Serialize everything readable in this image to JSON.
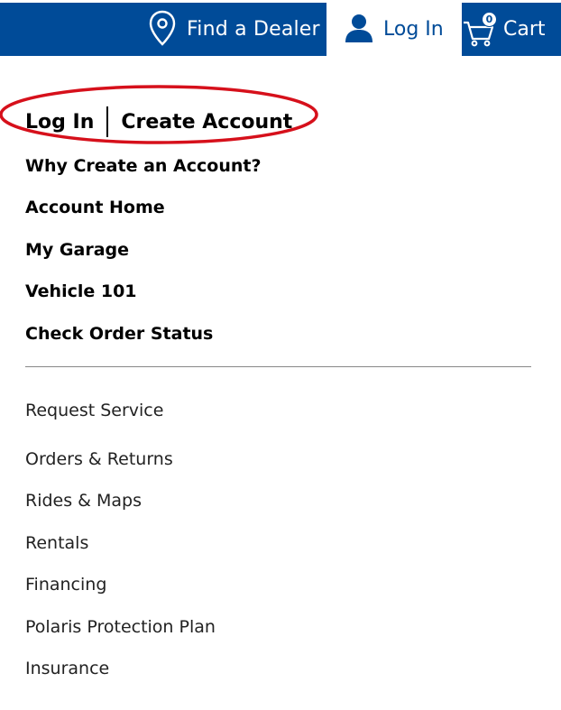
{
  "header": {
    "dealer_label": "Find a Dealer",
    "login_label": "Log In",
    "cart_label": "Cart",
    "cart_count": "0",
    "colors": {
      "brand_blue": "#004b98",
      "highlight_red": "#d6101b"
    }
  },
  "auth": {
    "login": "Log In",
    "create_account": "Create Account"
  },
  "account_links": [
    "Why Create an Account?",
    "Account Home",
    "My Garage",
    "Vehicle 101",
    "Check Order Status"
  ],
  "support_links": [
    "Request Service",
    "Orders & Returns",
    "Rides & Maps",
    "Rentals",
    "Financing",
    "Polaris Protection Plan",
    "Insurance"
  ],
  "icons": {
    "dealer": "location-pin-icon",
    "login": "user-icon",
    "cart": "cart-icon"
  }
}
